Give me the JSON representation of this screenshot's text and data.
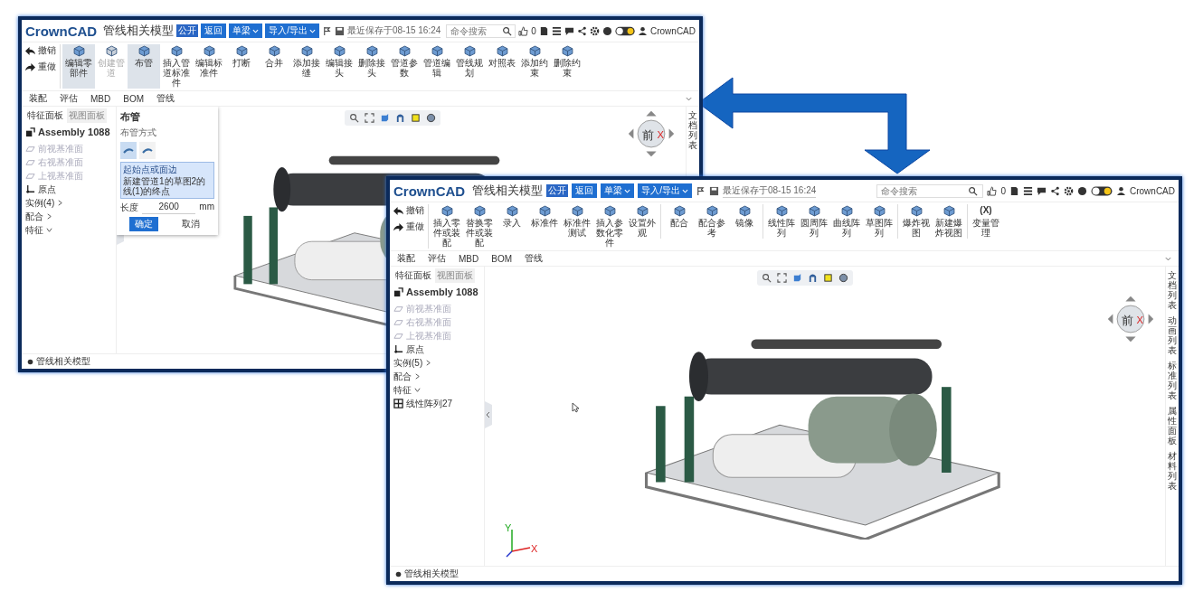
{
  "windows": [
    {
      "app_bar": {
        "logo": "CrownCAD",
        "title": "管线相关模型",
        "badge": "公开",
        "buttons": [
          {
            "label": "返回",
            "dropdown": false
          },
          {
            "label": "单梁",
            "dropdown": true
          },
          {
            "label": "导入/导出",
            "dropdown": true
          }
        ],
        "save_status": "最近保存于08-15 16:24",
        "search": {
          "placeholder": "命令搜索"
        },
        "like_count": "0",
        "user": "CrownCAD"
      },
      "toolbar": {
        "history": [
          {
            "label": "撤销",
            "kind": "undo"
          },
          {
            "label": "重做",
            "kind": "redo"
          }
        ],
        "groups": [
          {
            "items": [
              {
                "label": "编辑零部件",
                "selected": true,
                "disabled": false
              },
              {
                "label": "创建管道",
                "selected": false,
                "disabled": true
              },
              {
                "label": "布管",
                "selected": true,
                "disabled": false
              },
              {
                "label": "插入管道标准件",
                "selected": false,
                "disabled": false
              },
              {
                "label": "编辑标准件",
                "selected": false,
                "disabled": false
              },
              {
                "label": "打断",
                "selected": false,
                "disabled": false
              },
              {
                "label": "合并",
                "selected": false,
                "disabled": false
              },
              {
                "label": "添加接缝",
                "selected": false,
                "disabled": false
              },
              {
                "label": "编辑接头",
                "selected": false,
                "disabled": false
              },
              {
                "label": "删除接头",
                "selected": false,
                "disabled": false
              },
              {
                "label": "管道参数",
                "selected": false,
                "disabled": false
              },
              {
                "label": "管道编辑",
                "selected": false,
                "disabled": false
              },
              {
                "label": "管线规划",
                "selected": false,
                "disabled": false
              },
              {
                "label": "对照表",
                "selected": false,
                "disabled": false
              },
              {
                "label": "添加约束",
                "selected": false,
                "disabled": false
              },
              {
                "label": "删除约束",
                "selected": false,
                "disabled": false
              }
            ]
          }
        ]
      },
      "ribbon_tabs": [
        "装配",
        "评估",
        "MBD",
        "BOM",
        "管线"
      ],
      "panel_tabs": [
        {
          "label": "特征面板",
          "selected": true
        },
        {
          "label": "视图面板",
          "selected": false
        }
      ],
      "tree": {
        "root": "Assembly 1088",
        "items": [
          {
            "label": "前视基准面",
            "kind": "plane"
          },
          {
            "label": "右视基准面",
            "kind": "plane"
          },
          {
            "label": "上视基准面",
            "kind": "plane"
          },
          {
            "label": "原点",
            "kind": "origin"
          },
          {
            "label": "实例(4)",
            "kind": "group",
            "expanded": false
          },
          {
            "label": "配合",
            "kind": "group",
            "expanded": false
          },
          {
            "label": "特征",
            "kind": "group",
            "expanded": true
          }
        ]
      },
      "dialog": {
        "title": "布管",
        "section": "布管方式",
        "modes": [
          {
            "selected": true
          },
          {
            "selected": false
          }
        ],
        "field": {
          "label": "起始点或面边",
          "value": "新建管道1的草图2的线(1)的终点"
        },
        "length": {
          "label": "长度",
          "value": "2600",
          "unit": "mm"
        },
        "buttons": [
          {
            "label": "确定",
            "primary": true
          },
          {
            "label": "取消",
            "primary": false
          }
        ]
      },
      "view_cube": {
        "face": "前",
        "axis": "X"
      },
      "side_tabs": [
        "文档列表"
      ],
      "status_bar": "管线相关模型"
    },
    {
      "app_bar": {
        "logo": "CrownCAD",
        "title": "管线相关模型",
        "badge": "公开",
        "buttons": [
          {
            "label": "返回",
            "dropdown": false
          },
          {
            "label": "单梁",
            "dropdown": true
          },
          {
            "label": "导入/导出",
            "dropdown": true
          }
        ],
        "save_status": "最近保存于08-15 16:24",
        "search": {
          "placeholder": "命令搜索"
        },
        "like_count": "0",
        "user": "CrownCAD"
      },
      "toolbar": {
        "history": [
          {
            "label": "撤销",
            "kind": "undo"
          },
          {
            "label": "重做",
            "kind": "redo"
          }
        ],
        "groups": [
          {
            "items": [
              {
                "label": "插入零件或装配",
                "selected": false,
                "disabled": false
              },
              {
                "label": "替换零件或装配",
                "selected": false,
                "disabled": false
              },
              {
                "label": "录入",
                "selected": false,
                "disabled": false
              },
              {
                "label": "标准件",
                "selected": false,
                "disabled": false
              },
              {
                "label": "标准件测试",
                "selected": false,
                "disabled": false
              },
              {
                "label": "插入参数化零件",
                "selected": false,
                "disabled": false
              },
              {
                "label": "设置外观",
                "selected": false,
                "disabled": false
              }
            ]
          },
          {
            "items": [
              {
                "label": "配合",
                "selected": false,
                "disabled": false
              },
              {
                "label": "配合参考",
                "selected": false,
                "disabled": false
              },
              {
                "label": "镜像",
                "selected": false,
                "disabled": false
              }
            ]
          },
          {
            "items": [
              {
                "label": "线性阵列",
                "selected": false,
                "disabled": false
              },
              {
                "label": "圆周阵列",
                "selected": false,
                "disabled": false
              },
              {
                "label": "曲线阵列",
                "selected": false,
                "disabled": false
              },
              {
                "label": "草图阵列",
                "selected": false,
                "disabled": false
              }
            ]
          },
          {
            "items": [
              {
                "label": "爆炸视图",
                "selected": false,
                "disabled": false
              },
              {
                "label": "新建爆炸视图",
                "selected": false,
                "disabled": false
              }
            ]
          },
          {
            "items": [
              {
                "label": "变量管理",
                "glyph": "(X)",
                "selected": false,
                "disabled": false
              }
            ]
          }
        ]
      },
      "ribbon_tabs": [
        "装配",
        "评估",
        "MBD",
        "BOM",
        "管线"
      ],
      "panel_tabs": [
        {
          "label": "特征面板",
          "selected": true
        },
        {
          "label": "视图面板",
          "selected": false
        }
      ],
      "tree": {
        "root": "Assembly 1088",
        "items": [
          {
            "label": "前视基准面",
            "kind": "plane"
          },
          {
            "label": "右视基准面",
            "kind": "plane"
          },
          {
            "label": "上视基准面",
            "kind": "plane"
          },
          {
            "label": "原点",
            "kind": "origin"
          },
          {
            "label": "实例(5)",
            "kind": "group",
            "expanded": false
          },
          {
            "label": "配合",
            "kind": "group",
            "expanded": false
          },
          {
            "label": "特征",
            "kind": "group",
            "expanded": true
          },
          {
            "label": "线性阵列27",
            "kind": "pattern"
          }
        ]
      },
      "view_cube": {
        "face": "前",
        "axis": "X"
      },
      "triad": [
        "Y",
        "X"
      ],
      "side_tabs": [
        "文档列表",
        "动画列表",
        "标准列表",
        "属性面板",
        "材料列表"
      ],
      "status_bar": "管线相关模型"
    }
  ]
}
